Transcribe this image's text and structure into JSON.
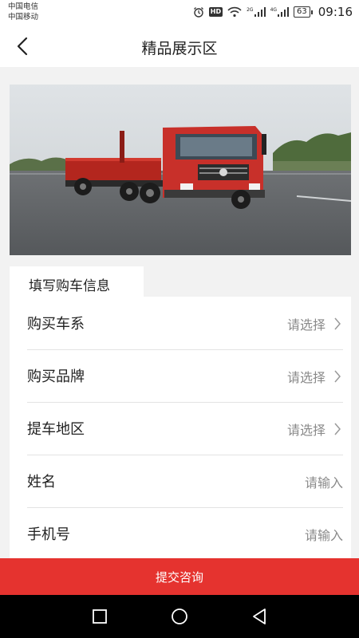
{
  "status_bar": {
    "carrier_1": "中国电信",
    "carrier_2": "中国移动",
    "hd_label": "HD",
    "network_1": "2G",
    "network_2": "4G",
    "battery_level": "63",
    "time": "09:16",
    "icons": [
      "alarm-icon",
      "hd-icon",
      "wifi-icon",
      "signal-icon",
      "signal-icon",
      "battery-icon"
    ]
  },
  "header": {
    "title": "精品展示区",
    "back_icon": "chevron-left-icon"
  },
  "form": {
    "title": "填写购车信息",
    "rows": [
      {
        "label": "购买车系",
        "value": "请选择",
        "icon": "chevron-right-icon"
      },
      {
        "label": "购买品牌",
        "value": "请选择",
        "icon": "chevron-right-icon"
      },
      {
        "label": "提车地区",
        "value": "请选择",
        "icon": "chevron-right-icon"
      },
      {
        "label": "姓名",
        "placeholder": "请输入"
      },
      {
        "label": "手机号",
        "placeholder": "请输入"
      }
    ]
  },
  "submit": {
    "label": "提交咨询"
  },
  "colors": {
    "accent": "#e5332f",
    "background": "#f2f2f2"
  },
  "nav_bar": {
    "icons": [
      "square-icon",
      "circle-icon",
      "triangle-back-icon"
    ]
  }
}
